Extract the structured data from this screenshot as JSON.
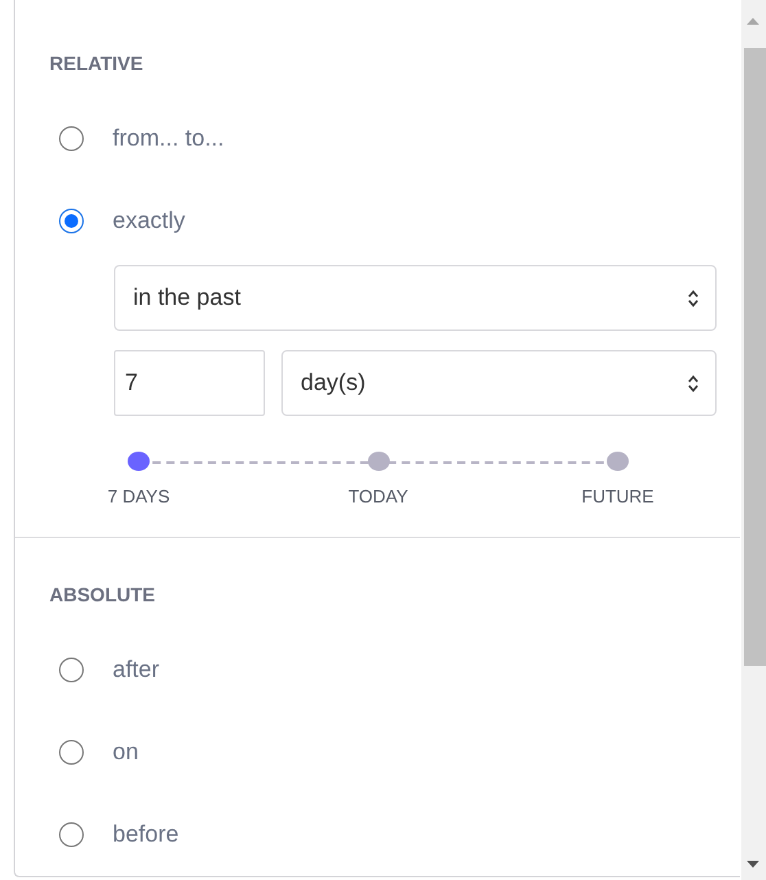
{
  "sections": [
    {
      "heading": "RELATIVE",
      "options": [
        {
          "label": "from... to...",
          "selected": false
        },
        {
          "label": "exactly",
          "selected": true,
          "details": {
            "direction": "in the past",
            "amount": "7",
            "unit": "day(s)",
            "timeline": [
              {
                "label": "7 DAYS",
                "selected": true
              },
              {
                "label": "TODAY",
                "selected": false
              },
              {
                "label": "FUTURE",
                "selected": false
              }
            ]
          }
        }
      ]
    },
    {
      "heading": "ABSOLUTE",
      "options": [
        {
          "label": "after",
          "selected": false
        },
        {
          "label": "on",
          "selected": false
        },
        {
          "label": "before",
          "selected": false
        }
      ]
    }
  ]
}
